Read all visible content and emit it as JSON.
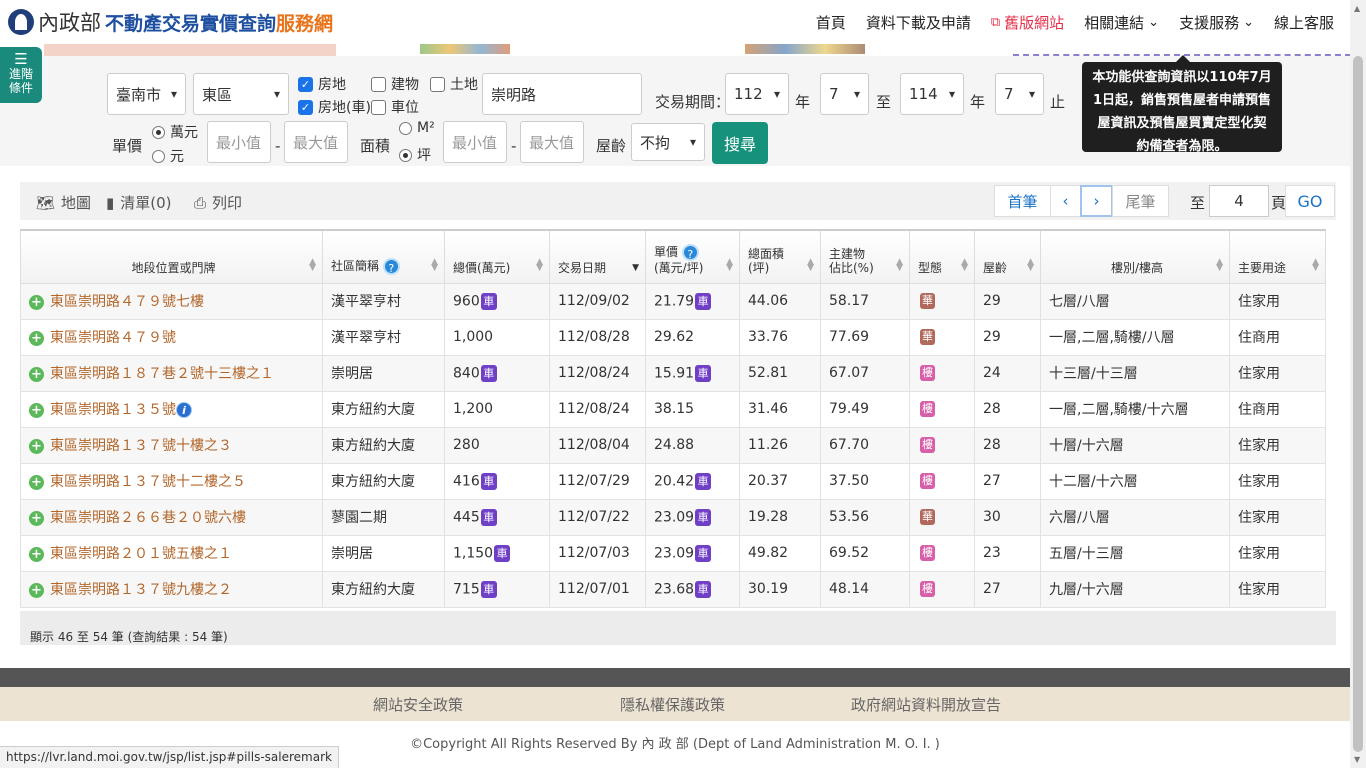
{
  "header": {
    "moi": "內政部",
    "title": "不動產交易實價查詢",
    "title_accent": "服務網",
    "nav": [
      {
        "label": "首頁"
      },
      {
        "label": "資料下載及申請"
      },
      {
        "label": "舊版網站",
        "icon": "external-link-icon",
        "color": "#e3304a"
      },
      {
        "label": "相關連結",
        "dropdown": true
      },
      {
        "label": "支援服務",
        "dropdown": true
      },
      {
        "label": "線上客服"
      }
    ]
  },
  "filter": {
    "advanced_label_1": "進階",
    "advanced_label_2": "條件",
    "city": "臺南市",
    "district": "東區",
    "types": {
      "land_building": "房地",
      "building": "建物",
      "land": "土地",
      "land_building_parking": "房地(車)",
      "parking": "車位"
    },
    "road": "崇明路",
    "period_label": "交易期間：",
    "from_year": "112",
    "from_month": "7",
    "to_label": "至",
    "to_year": "114",
    "to_month": "7",
    "year_unit": "年",
    "until_unit": "止",
    "unit_price_label": "單價",
    "unit_wan": "萬元",
    "unit_yuan": "元",
    "min_placeholder": "最小值",
    "max_placeholder": "最大值",
    "dash": "-",
    "area_label": "面積",
    "area_m2": "M²",
    "area_ping": "坪",
    "age_label": "屋齡",
    "age_value": "不拘",
    "search_button": "搜尋",
    "tooltip": "本功能供查詢資訊以110年7月1日起，銷售預售屋者申請預售屋資訊及預售屋買賣定型化契約備查者為限。"
  },
  "toolbar": {
    "map": "地圖",
    "list": "清單(0)",
    "print": "列印",
    "first": "首筆",
    "prev": "‹",
    "next": "›",
    "last": "尾筆",
    "goto_label": "至",
    "page_value": "4",
    "page_unit": "頁",
    "go": "GO"
  },
  "table": {
    "headers": [
      "地段位置或門牌",
      "社區簡稱",
      "總價(萬元)",
      "交易日期",
      "單價\n(萬元/坪)",
      "總面積\n(坪)",
      "主建物\n佔比(%)",
      "型態",
      "屋齡",
      "樓別/樓高",
      "主要用途"
    ],
    "rows": [
      {
        "addr": "東區崇明路４７９號七樓",
        "community": "漢平翠亨村",
        "total": "960",
        "total_car": true,
        "date": "112/09/02",
        "unit": "21.79",
        "unit_car": true,
        "area": "44.06",
        "ratio": "58.17",
        "type": "華",
        "type_color": "brown",
        "age": "29",
        "floor": "七層/八層",
        "use": "住家用"
      },
      {
        "addr": "東區崇明路４７９號",
        "community": "漢平翠亨村",
        "total": "1,000",
        "total_car": false,
        "date": "112/08/28",
        "unit": "29.62",
        "unit_car": false,
        "area": "33.76",
        "ratio": "77.69",
        "type": "華",
        "type_color": "brown",
        "age": "29",
        "floor": "一層,二層,騎樓/八層",
        "use": "住商用"
      },
      {
        "addr": "東區崇明路１８７巷２號十三樓之１",
        "community": "崇明居",
        "total": "840",
        "total_car": true,
        "date": "112/08/24",
        "unit": "15.91",
        "unit_car": true,
        "area": "52.81",
        "ratio": "67.07",
        "type": "樓",
        "type_color": "pink",
        "age": "24",
        "floor": "十三層/十三層",
        "use": "住家用"
      },
      {
        "addr": "東區崇明路１３５號",
        "info": true,
        "community": "東方紐約大廈",
        "total": "1,200",
        "total_car": false,
        "date": "112/08/24",
        "unit": "38.15",
        "unit_car": false,
        "area": "31.46",
        "ratio": "79.49",
        "type": "樓",
        "type_color": "pink",
        "age": "28",
        "floor": "一層,二層,騎樓/十六層",
        "use": "住商用"
      },
      {
        "addr": "東區崇明路１３７號十樓之３",
        "community": "東方紐約大廈",
        "total": "280",
        "total_car": false,
        "date": "112/08/04",
        "unit": "24.88",
        "unit_car": false,
        "area": "11.26",
        "ratio": "67.70",
        "type": "樓",
        "type_color": "pink",
        "age": "28",
        "floor": "十層/十六層",
        "use": "住家用"
      },
      {
        "addr": "東區崇明路１３７號十二樓之５",
        "community": "東方紐約大廈",
        "total": "416",
        "total_car": true,
        "date": "112/07/29",
        "unit": "20.42",
        "unit_car": true,
        "area": "20.37",
        "ratio": "37.50",
        "type": "樓",
        "type_color": "pink",
        "age": "27",
        "floor": "十二層/十六層",
        "use": "住家用"
      },
      {
        "addr": "東區崇明路２６６巷２０號六樓",
        "community": "蓼園二期",
        "total": "445",
        "total_car": true,
        "date": "112/07/22",
        "unit": "23.09",
        "unit_car": true,
        "area": "19.28",
        "ratio": "53.56",
        "type": "華",
        "type_color": "brown",
        "age": "30",
        "floor": "六層/八層",
        "use": "住家用"
      },
      {
        "addr": "東區崇明路２０１號五樓之１",
        "community": "崇明居",
        "total": "1,150",
        "total_car": true,
        "date": "112/07/03",
        "unit": "23.09",
        "unit_car": true,
        "area": "49.82",
        "ratio": "69.52",
        "type": "樓",
        "type_color": "pink",
        "age": "23",
        "floor": "五層/十三層",
        "use": "住家用"
      },
      {
        "addr": "東區崇明路１３７號九樓之２",
        "community": "東方紐約大廈",
        "total": "715",
        "total_car": true,
        "date": "112/07/01",
        "unit": "23.68",
        "unit_car": true,
        "area": "30.19",
        "ratio": "48.14",
        "type": "樓",
        "type_color": "pink",
        "age": "27",
        "floor": "九層/十六層",
        "use": "住家用"
      }
    ],
    "car_label": "車",
    "info_label": "i",
    "plus_label": "+"
  },
  "summary": "顯示 46 至 54 筆 (查詢結果 : 54 筆)",
  "footer": {
    "links": [
      "網站安全政策",
      "隱私權保護政策",
      "政府網站資料開放宣告"
    ],
    "copyright": "©Copyright All Rights Reserved By 內 政 部 (Dept of Land Administration M. O. I. )"
  },
  "status_url": "https://lvr.land.moi.gov.tw/jsp/list.jsp#pills-saleremark",
  "colors": {
    "brand_blue": "#1e4fa0",
    "brand_orange": "#e8741c",
    "teal": "#16917b",
    "address_link": "#b3672b",
    "car_badge": "#6f3fc6"
  }
}
